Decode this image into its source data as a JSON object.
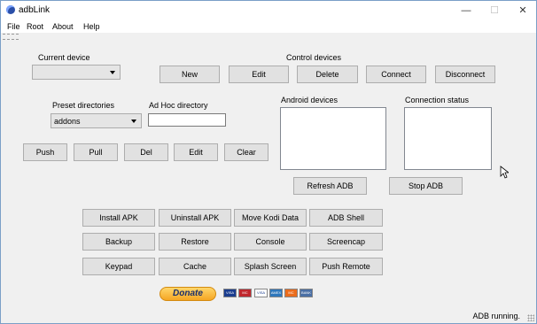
{
  "titlebar": {
    "title": "adbLink",
    "minimize": "—",
    "maximize": "☐",
    "close": "✕"
  },
  "menu": [
    "File",
    "Root",
    "About",
    "Help"
  ],
  "labels": {
    "current_device": "Current device",
    "control_devices": "Control devices",
    "preset_directories": "Preset directories",
    "adhoc_directory": "Ad Hoc directory",
    "android_devices": "Android devices",
    "connection_status": "Connection status"
  },
  "current_device_value": "",
  "preset_value": "addons",
  "adhoc_value": "",
  "control_buttons": [
    "New",
    "Edit",
    "Delete",
    "Connect",
    "Disconnect"
  ],
  "file_buttons": [
    "Push",
    "Pull",
    "Del",
    "Edit",
    "Clear"
  ],
  "adb_buttons": {
    "refresh": "Refresh ADB",
    "stop": "Stop ADB"
  },
  "grid_buttons": [
    [
      "Install APK",
      "Uninstall APK",
      "Move Kodi Data",
      "ADB Shell"
    ],
    [
      "Backup",
      "Restore",
      "Console",
      "Screencap"
    ],
    [
      "Keypad",
      "Cache",
      "Splash Screen",
      "Push Remote"
    ]
  ],
  "donate_label": "Donate",
  "cards": [
    "VISA",
    "MC",
    "VISA",
    "AMEX",
    "MC",
    "BANK"
  ],
  "card_colors": [
    "#1a3d8f",
    "#c0272d",
    "#ffffff",
    "#2e77bc",
    "#eb6c1c",
    "#4a6fa5"
  ],
  "status": "ADB running."
}
